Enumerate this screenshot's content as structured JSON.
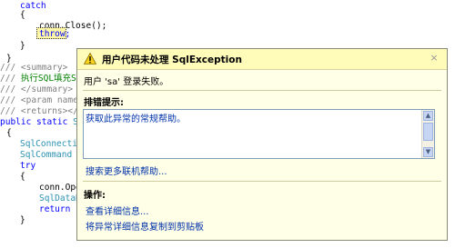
{
  "code": {
    "l1": "catch",
    "l2": "{",
    "l3": "conn.Close();",
    "l4": "throw;",
    "l5": "}",
    "l6": "}",
    "l7a": "/// ",
    "l7b": "<summary>",
    "l8a": "/// ",
    "l8b": "执行SQL填充S",
    "l9a": "/// ",
    "l9b": "</summary>",
    "l10a": "/// ",
    "l10b": "<param name=",
    "l11a": "/// ",
    "l11b": "<returns></r",
    "l12a": "public static ",
    "l12b": "Sq",
    "l13": "{",
    "l14": "SqlConnectio",
    "l15": "SqlCommand c",
    "l16": "try",
    "l17": "{",
    "l18": "conn.Ope",
    "l19": "SqlDataR",
    "l20": "return s",
    "l21": "}"
  },
  "dialog": {
    "title": "用户代码未处理 SqlException",
    "message": "用户 'sa' 登录失败。",
    "tips_header": "排错提示:",
    "tip_item": "获取此异常的常规帮助。",
    "more_help_link": "搜索更多联机帮助...",
    "actions_header": "操作:",
    "action_view_details": "查看详细信息...",
    "action_copy": "将异常详细信息复制到剪贴板",
    "close_glyph": "×",
    "warning_icon": "warning-triangle-icon"
  },
  "colors": {
    "keyword": "#0000ff",
    "comment": "#008000",
    "type": "#2b91af",
    "dialog_bg": "#fffee6",
    "link": "#0033aa"
  }
}
